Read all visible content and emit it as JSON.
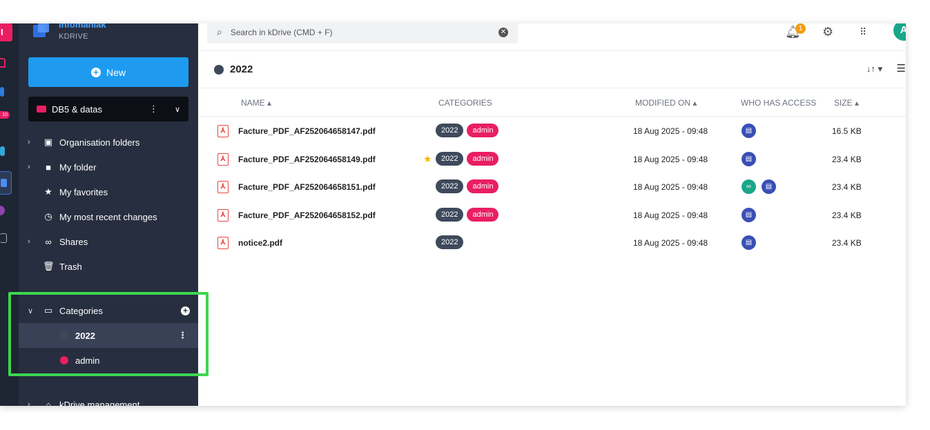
{
  "colors": {
    "accent": "#1e9bf0",
    "sidebar_bg": "#272e3f",
    "highlight": "#3dd64f",
    "tag_2022": "#3e4a5c",
    "tag_admin": "#e91e63",
    "pdf_red": "#e84545"
  },
  "rail": {
    "top_label": "I",
    "badge": "10"
  },
  "brand": {
    "name": "infomaniak",
    "product": "KDRIVE"
  },
  "sidebar": {
    "new_label": "New",
    "drive_name": "DB5 & datas",
    "nav": [
      {
        "label": "Organisation folders",
        "icon": "org-folder-icon"
      },
      {
        "label": "My folder",
        "icon": "folder-icon"
      },
      {
        "label": "My favorites",
        "icon": "star-icon"
      },
      {
        "label": "My most recent changes",
        "icon": "clock-icon"
      },
      {
        "label": "Shares",
        "icon": "link-icon"
      },
      {
        "label": "Trash",
        "icon": "trash-icon"
      }
    ],
    "categories_label": "Categories",
    "categories": [
      {
        "label": "2022",
        "color": "#3e4a5c"
      },
      {
        "label": "admin",
        "color": "#e91e63"
      }
    ],
    "management_label": "kDrive management"
  },
  "search": {
    "placeholder": "Search in kDrive (CMD + F)"
  },
  "topbar": {
    "notif_count": "1",
    "avatar_initial": "A"
  },
  "main": {
    "title": "2022",
    "columns": {
      "name": "NAME",
      "categories": "CATEGORIES",
      "modified": "MODIFIED ON",
      "access": "WHO HAS ACCESS",
      "size": "SIZE"
    },
    "files": [
      {
        "name": "Facture_PDF_AF252064658147.pdf",
        "favorite": false,
        "tags": [
          "2022",
          "admin"
        ],
        "modified": "18 Aug 2025 - 09:48",
        "access": [
          "drive"
        ],
        "size": "16.5 KB"
      },
      {
        "name": "Facture_PDF_AF252064658149.pdf",
        "favorite": true,
        "tags": [
          "2022",
          "admin"
        ],
        "modified": "18 Aug 2025 - 09:48",
        "access": [
          "drive"
        ],
        "size": "23.4 KB"
      },
      {
        "name": "Facture_PDF_AF252064658151.pdf",
        "favorite": false,
        "tags": [
          "2022",
          "admin"
        ],
        "modified": "18 Aug 2025 - 09:48",
        "access": [
          "link",
          "drive"
        ],
        "size": "23.4 KB"
      },
      {
        "name": "Facture_PDF_AF252064658152.pdf",
        "favorite": false,
        "tags": [
          "2022",
          "admin"
        ],
        "modified": "18 Aug 2025 - 09:48",
        "access": [
          "drive"
        ],
        "size": "23.4 KB"
      },
      {
        "name": "notice2.pdf",
        "favorite": false,
        "tags": [
          "2022"
        ],
        "modified": "18 Aug 2025 - 09:48",
        "access": [
          "drive"
        ],
        "size": "23.4 KB"
      }
    ]
  }
}
